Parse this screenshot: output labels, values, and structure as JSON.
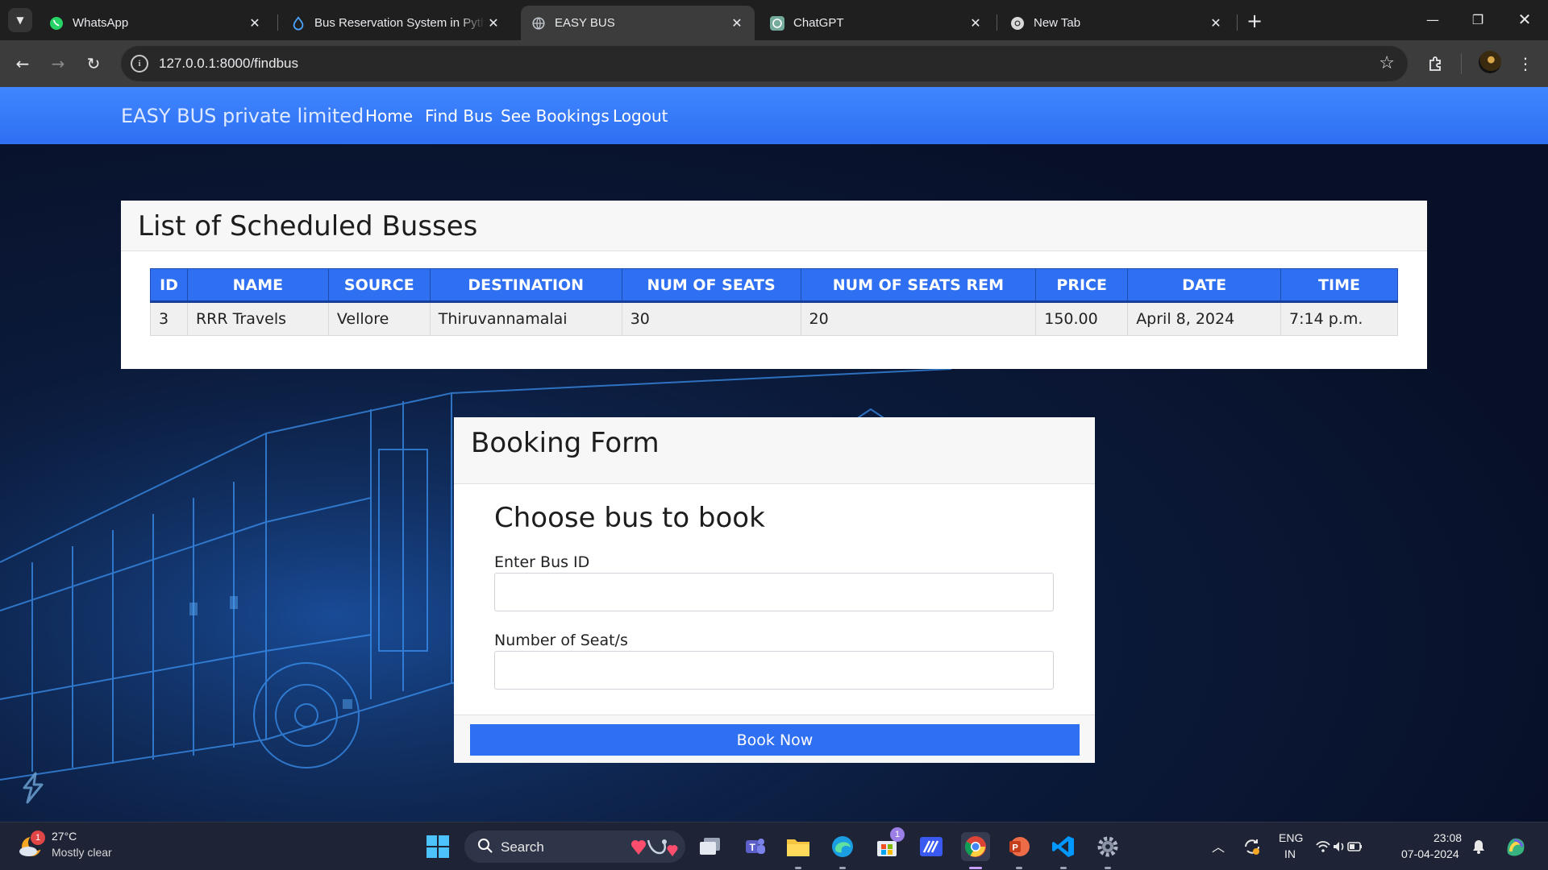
{
  "browser": {
    "tabs": [
      {
        "title": "WhatsApp",
        "icon": "whatsapp-icon",
        "active": false
      },
      {
        "title": "Bus Reservation System in Python",
        "icon": "drupal-drop-icon",
        "active": false
      },
      {
        "title": "EASY BUS",
        "icon": "globe-icon",
        "active": true
      },
      {
        "title": "ChatGPT",
        "icon": "chatgpt-icon",
        "active": false
      },
      {
        "title": "New Tab",
        "icon": "chrome-icon",
        "active": false
      }
    ],
    "url": "127.0.0.1:8000/findbus"
  },
  "navbar": {
    "brand": "EASY BUS private limited",
    "links": [
      "Home",
      "Find Bus",
      "See Bookings",
      "Logout"
    ]
  },
  "schedule": {
    "title": "List of Scheduled Busses",
    "columns": [
      "ID",
      "NAME",
      "SOURCE",
      "DESTINATION",
      "NUM OF SEATS",
      "NUM OF SEATS REM",
      "PRICE",
      "DATE",
      "TIME"
    ],
    "rows": [
      [
        "3",
        "RRR Travels",
        "Vellore",
        "Thiruvannamalai",
        "30",
        "20",
        "150.00",
        "April 8, 2024",
        "7:14 p.m."
      ]
    ]
  },
  "booking": {
    "title": "Booking Form",
    "subtitle": "Choose bus to book",
    "bus_id_label": "Enter Bus ID",
    "bus_id_value": "",
    "seats_label": "Number of Seat/s",
    "seats_value": "",
    "submit_label": "Book Now"
  },
  "taskbar": {
    "weather_temp": "27°C",
    "weather_desc": "Mostly clear",
    "weather_badge": "1",
    "search_label": "Search",
    "store_badge": "1",
    "lang_top": "ENG",
    "lang_bottom": "IN",
    "time": "23:08",
    "date": "07-04-2024"
  },
  "colors": {
    "accent": "#2f6ff2",
    "navbar": "#3f86ff",
    "page_bg": "#0b1430"
  }
}
